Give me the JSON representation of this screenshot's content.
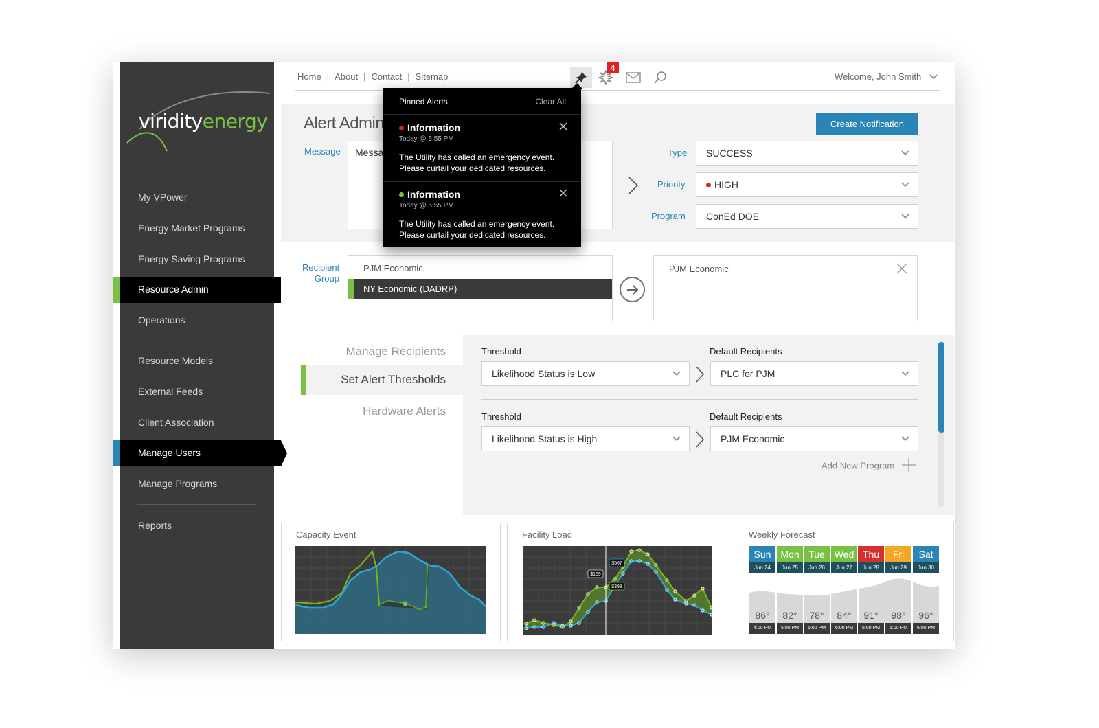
{
  "brand": {
    "logo_part1": "viridity",
    "logo_part2": "energy"
  },
  "sidebar": {
    "items": [
      {
        "label": "My VPower"
      },
      {
        "label": "Energy Market Programs"
      },
      {
        "label": "Energy Saving Programs"
      },
      {
        "label": "Resource Admin"
      },
      {
        "label": "Operations"
      },
      {
        "label": "Resource Models"
      },
      {
        "label": "External Feeds"
      },
      {
        "label": "Client Association"
      },
      {
        "label": "Manage Users"
      },
      {
        "label": "Manage Programs"
      },
      {
        "label": "Reports"
      }
    ],
    "active_colors": {
      "resource_admin": "#7ac143",
      "manage_users": "#2a84b6"
    }
  },
  "topnav": {
    "links": [
      "Home",
      "About",
      "Contact",
      "Sitemap"
    ],
    "notification_count": "4",
    "welcome": "Welcome, John Smith"
  },
  "pinned_alerts": {
    "title": "Pinned Alerts",
    "clear_all": "Clear All",
    "alerts": [
      {
        "type": "Information",
        "time": "Today @ 5:55 PM",
        "line1": "The Utility has called an emergency event.",
        "line2": "Please curtail your dedicated resources.",
        "dot_color": "#e41f1f"
      },
      {
        "type": "Information",
        "time": "Today @ 5:55 PM",
        "line1": "The Utility has called an emergency event.",
        "line2": "Please curtail your dedicated resources.",
        "dot_color": "#7ac143"
      }
    ]
  },
  "alert_admin": {
    "title": "Alert Admin",
    "message_label": "Message",
    "message_value": "Messa",
    "create_button": "Create  Notification",
    "type_label": "Type",
    "type_value": "SUCCESS",
    "priority_label": "Priority",
    "priority_value": "HIGH",
    "priority_color": "#e41f1f",
    "program_label": "Program",
    "program_value": "ConEd DOE"
  },
  "recipients": {
    "label_line1": "Recipient",
    "label_line2": "Group",
    "options": [
      "PJM Economic",
      "NY Economic (DADRP)"
    ],
    "selected_target": "PJM Economic"
  },
  "tabs": [
    "Manage Recipients",
    "Set Alert Thresholds",
    "Hardware Alerts"
  ],
  "thresholds": [
    {
      "threshold_label": "Threshold",
      "threshold_value": "Likelihood Status is Low",
      "recipients_label": "Default Recipients",
      "recipients_value": "PLC for PJM"
    },
    {
      "threshold_label": "Threshold",
      "threshold_value": "Likelihood Status is High",
      "recipients_label": "Default Recipients",
      "recipients_value": "PJM Economic"
    }
  ],
  "add_program": "Add New Program",
  "widgets": {
    "capacity_title": "Capacity Event",
    "facility_title": "Facility Load",
    "facility_tags": [
      "$169",
      "$567",
      "$398"
    ],
    "forecast_title": "Weekly Forecast",
    "forecast": [
      {
        "day": "Sun",
        "date": "Jun 24",
        "temp": "86°",
        "time": "4:00 PM",
        "color": "#2a84b6"
      },
      {
        "day": "Mon",
        "date": "Jun 25",
        "temp": "82°",
        "time": "5:00 PM",
        "color": "#7ac143"
      },
      {
        "day": "Tue",
        "date": "Jun 26",
        "temp": "78°",
        "time": "6:00 PM",
        "color": "#7ac143"
      },
      {
        "day": "Wed",
        "date": "Jun 27",
        "temp": "84°",
        "time": "6:00 PM",
        "color": "#7ac143"
      },
      {
        "day": "Thu",
        "date": "Jun 28",
        "temp": "91°",
        "time": "5:00 PM",
        "color": "#d62f2f"
      },
      {
        "day": "Fri",
        "date": "Jun 29",
        "temp": "98°",
        "time": "5:00 PM",
        "color": "#f5a623"
      },
      {
        "day": "Sat",
        "date": "Jun 30",
        "temp": "96°",
        "time": "6:00 PM",
        "color": "#2a84b6"
      }
    ]
  }
}
